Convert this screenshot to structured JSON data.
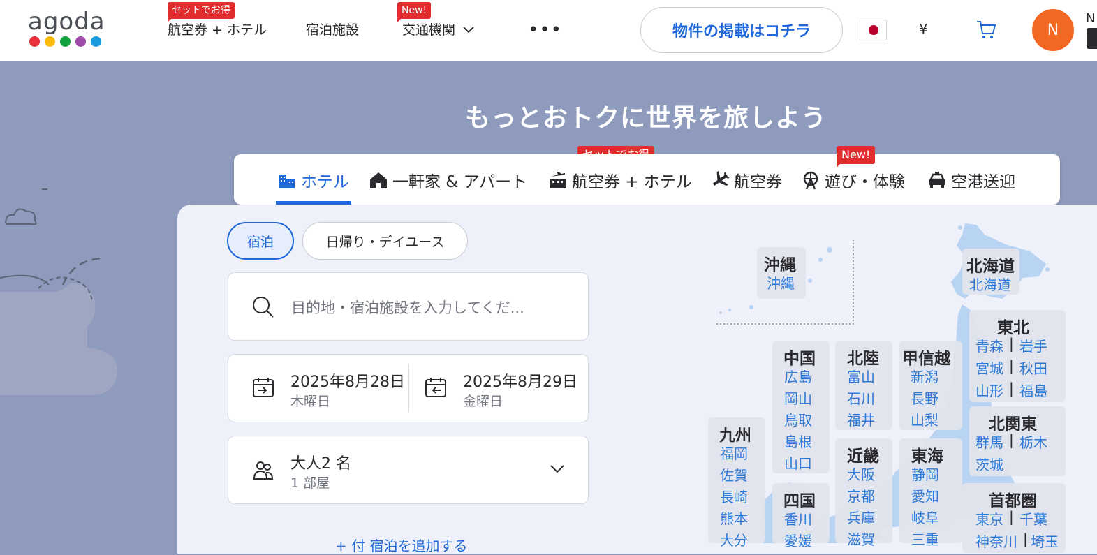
{
  "header": {
    "logo_text": "agoda",
    "logo_dots": [
      "#e8313b",
      "#fbbc05",
      "#12a03c",
      "#9d4aa8",
      "#1a9be0"
    ],
    "nav": [
      {
        "label": "航空券 + ホテル",
        "badge": "セットでお得"
      },
      {
        "label": "宿泊施設",
        "badge": ""
      },
      {
        "label": "交通機関",
        "badge": "New!"
      }
    ],
    "more_label": "•••",
    "list_property_label": "物件の掲載はコチラ",
    "currency": "¥",
    "avatar_initial": "N",
    "edge_text": "N"
  },
  "hero": {
    "title": "もっとおトクに世界を旅しよう"
  },
  "tabs": [
    {
      "label": "ホテル",
      "icon": "hotel-icon",
      "badge": ""
    },
    {
      "label": "一軒家 & アパート",
      "icon": "house-icon",
      "badge": ""
    },
    {
      "label": "航空券 + ホテル",
      "icon": "flight-hotel-icon",
      "badge": "セットでお得"
    },
    {
      "label": "航空券",
      "icon": "airplane-icon",
      "badge": ""
    },
    {
      "label": "遊び・体験",
      "icon": "ferris-wheel-icon",
      "badge": "New!"
    },
    {
      "label": "空港送迎",
      "icon": "car-icon",
      "badge": ""
    }
  ],
  "search": {
    "stay_type_active": "宿泊",
    "stay_type_other": "日帰り・デイユース",
    "destination_placeholder": "目的地・宿泊施設を入力してくだ...",
    "checkin_date": "2025年8月28日",
    "checkin_day": "木曜日",
    "checkout_date": "2025年8月29日",
    "checkout_day": "金曜日",
    "guests": "大人2 名",
    "rooms": "1 部屋",
    "add_link": "+ 付 宿泊を追加する"
  },
  "map": {
    "regions": [
      {
        "name": "沖縄",
        "prefs": [
          "沖縄"
        ]
      },
      {
        "name": "北海道",
        "prefs": [
          "北海道"
        ]
      },
      {
        "name": "東北",
        "prefs": [
          "青森",
          "岩手",
          "宮城",
          "秋田",
          "山形",
          "福島"
        ]
      },
      {
        "name": "北関東",
        "prefs": [
          "群馬",
          "栃木",
          "茨城"
        ]
      },
      {
        "name": "首都圏",
        "prefs": [
          "東京",
          "千葉",
          "神奈川",
          "埼玉"
        ]
      },
      {
        "name": "中国",
        "prefs": [
          "広島",
          "岡山",
          "鳥取",
          "島根",
          "山口"
        ]
      },
      {
        "name": "北陸",
        "prefs": [
          "富山",
          "石川",
          "福井"
        ]
      },
      {
        "name": "甲信越",
        "prefs": [
          "新潟",
          "長野",
          "山梨"
        ]
      },
      {
        "name": "近畿",
        "prefs": [
          "大阪",
          "京都",
          "兵庫",
          "滋賀"
        ]
      },
      {
        "name": "東海",
        "prefs": [
          "静岡",
          "愛知",
          "岐阜",
          "三重"
        ]
      },
      {
        "name": "九州",
        "prefs": [
          "福岡",
          "佐賀",
          "長崎",
          "熊本",
          "大分"
        ]
      },
      {
        "name": "四国",
        "prefs": [
          "香川",
          "愛媛"
        ]
      }
    ]
  }
}
